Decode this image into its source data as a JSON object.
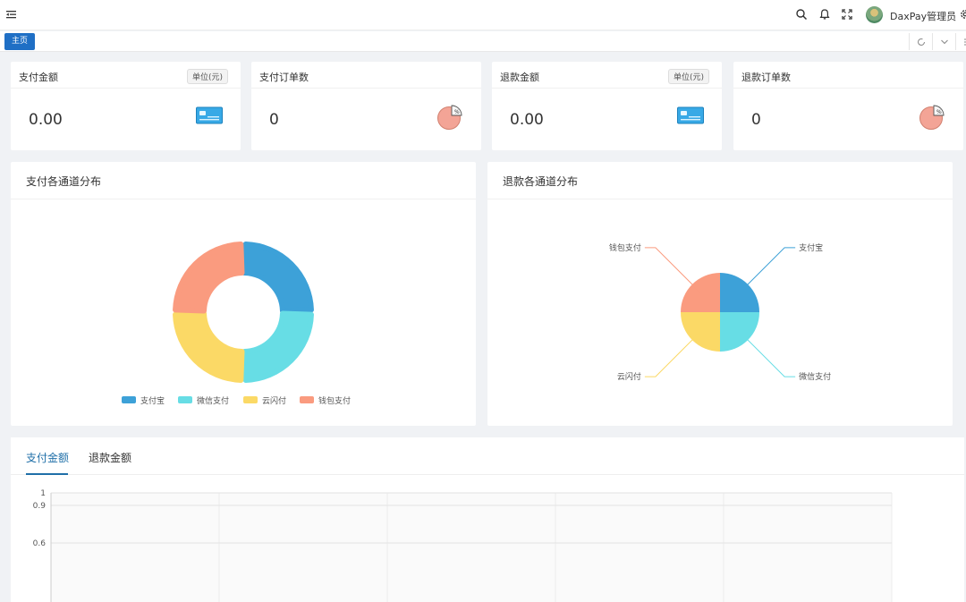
{
  "header": {
    "username": "DaxPay管理员",
    "icons": [
      "menu-fold-icon",
      "search-icon",
      "bell-icon",
      "fullscreen-icon",
      "settings-icon"
    ]
  },
  "tabs": {
    "home_label": "主页"
  },
  "stats": [
    {
      "title": "支付金额",
      "badge": "单位(元)",
      "value": "0.00",
      "icon": "credit-card-icon"
    },
    {
      "title": "支付订单数",
      "badge": "",
      "value": "0",
      "icon": "pie-chart-icon"
    },
    {
      "title": "退款金额",
      "badge": "单位(元)",
      "value": "0.00",
      "icon": "credit-card-icon"
    },
    {
      "title": "退款订单数",
      "badge": "",
      "value": "0",
      "icon": "pie-chart-icon"
    }
  ],
  "pay_channel_panel": {
    "title": "支付各通道分布"
  },
  "refund_channel_panel": {
    "title": "退款各通道分布"
  },
  "bottom_tabs": {
    "active": "支付金额",
    "inactive": "退款金额"
  },
  "colors": {
    "primary": "#1f6fc5",
    "tab_active": "#1f6fa8"
  },
  "chart_data": [
    {
      "type": "pie",
      "title": "支付各通道分布",
      "variant": "donut",
      "categories": [
        "支付宝",
        "微信支付",
        "云闪付",
        "钱包支付"
      ],
      "values": [
        1,
        1,
        1,
        1
      ],
      "colors": [
        "#3da1d8",
        "#67dde5",
        "#fbd966",
        "#fa9b7f"
      ],
      "legend_position": "bottom"
    },
    {
      "type": "pie",
      "title": "退款各通道分布",
      "categories": [
        "支付宝",
        "微信支付",
        "云闪付",
        "钱包支付"
      ],
      "values": [
        1,
        1,
        1,
        1
      ],
      "colors": [
        "#3da1d8",
        "#67dde5",
        "#fbd966",
        "#fa9b7f"
      ],
      "labels": "outside"
    },
    {
      "type": "line",
      "title": "支付金额",
      "y_ticks": [
        "1",
        "0.9",
        "0.6"
      ],
      "ylim": [
        0,
        1
      ],
      "grid": true
    }
  ]
}
